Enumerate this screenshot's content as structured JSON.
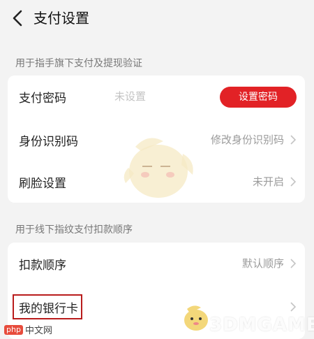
{
  "header": {
    "title": "支付设置"
  },
  "section1": {
    "label": "用于指手旗下支付及提现验证",
    "rows": [
      {
        "label": "支付密码",
        "mid_value": "未设置",
        "button": "设置密码"
      },
      {
        "label": "身份识别码",
        "value": "修改身份识别码"
      },
      {
        "label": "刷脸设置",
        "value": "未开启"
      }
    ]
  },
  "section2": {
    "label": "用于线下指纹支付扣款顺序",
    "rows": [
      {
        "label": "扣款顺序",
        "value": "默认顺序"
      },
      {
        "label": "我的银行卡"
      }
    ]
  },
  "watermark": {
    "brand": "3DMGAME",
    "site": "中文网",
    "badge": "php"
  },
  "colors": {
    "accent": "#e22226",
    "background": "#f3f3f3",
    "highlight": "#b91c1c"
  },
  "icons": {
    "back": "chevron-left-icon",
    "row_arrow": "chevron-right-icon"
  }
}
